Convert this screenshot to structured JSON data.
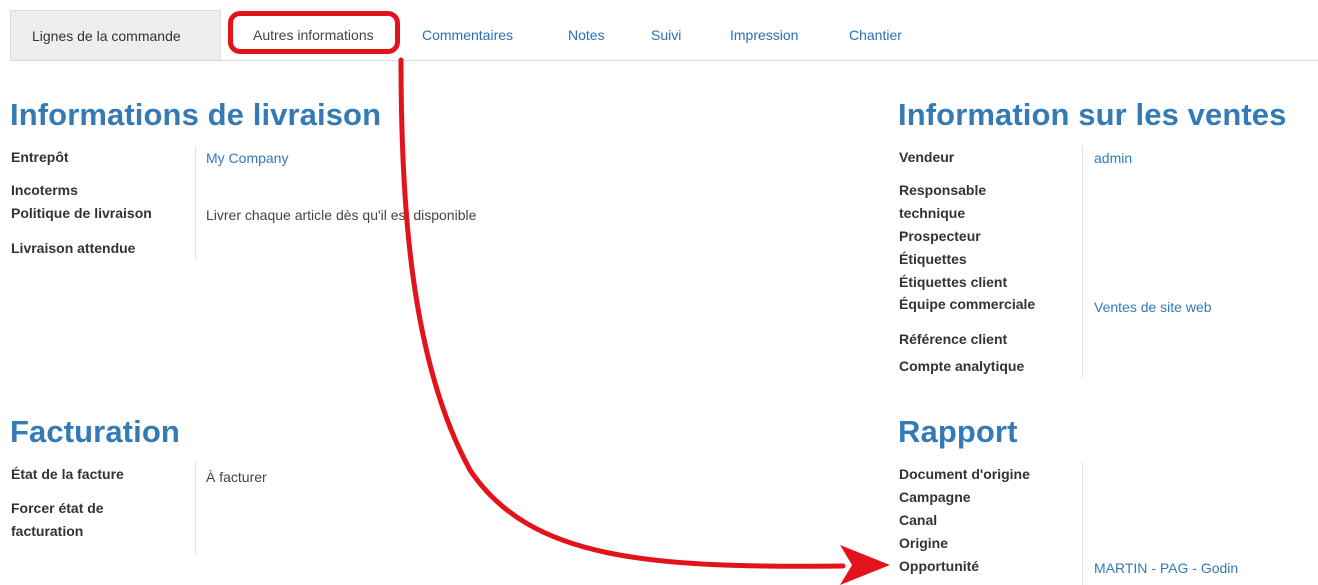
{
  "tabs": [
    {
      "label": "Lignes de la commande"
    },
    {
      "label": "Autres informations"
    },
    {
      "label": "Commentaires"
    },
    {
      "label": "Notes"
    },
    {
      "label": "Suivi"
    },
    {
      "label": "Impression"
    },
    {
      "label": "Chantier"
    }
  ],
  "delivery": {
    "title": "Informations de livraison",
    "labels": {
      "warehouse": "Entrepôt",
      "incoterms": "Incoterms",
      "policy": "Politique de livraison",
      "expected": "Livraison attendue"
    },
    "values": {
      "warehouse": "My Company",
      "policy": "Livrer chaque article dès qu'il est disponible"
    }
  },
  "sales": {
    "title": "Information sur les ventes",
    "labels": {
      "salesperson": "Vendeur",
      "tech_resp_1": "Responsable",
      "tech_resp_2": "technique",
      "prospector": "Prospecteur",
      "tags": "Étiquettes",
      "client_tags": "Étiquettes client",
      "sales_team": "Équipe commerciale",
      "client_ref": "Référence client",
      "analytic": "Compte analytique"
    },
    "values": {
      "salesperson": "admin",
      "sales_team": "Ventes de site web"
    }
  },
  "billing": {
    "title": "Facturation",
    "labels": {
      "invoice_state": "État de la facture",
      "force_1": "Forcer état de",
      "force_2": "facturation"
    },
    "values": {
      "invoice_state": "À facturer"
    }
  },
  "report": {
    "title": "Rapport",
    "labels": {
      "source_doc": "Document d'origine",
      "campaign": "Campagne",
      "channel": "Canal",
      "origin": "Origine",
      "opportunity": "Opportunité"
    },
    "values": {
      "opportunity": "MARTIN - PAG - Godin"
    }
  },
  "annotation": {
    "color": "#e3131c"
  },
  "colors": {
    "accent": "#337ab7",
    "annotation_red": "#e3131c",
    "tab_active_bg": "#eeeeee"
  }
}
